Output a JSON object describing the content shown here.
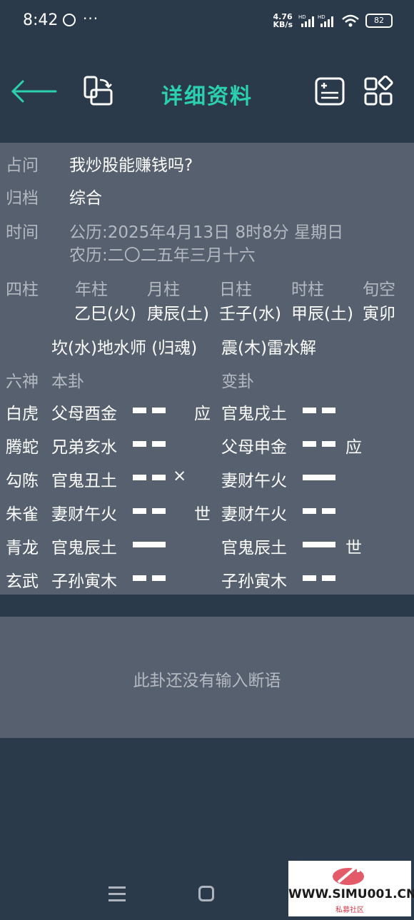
{
  "status": {
    "time": "8:42",
    "dots": "···",
    "speed": "4.76\nKB/s",
    "battery": "82"
  },
  "toolbar": {
    "title": "详细资料"
  },
  "info": {
    "question_label": "占问",
    "question": "我炒股能赚钱吗?",
    "category_label": "归档",
    "category": "综合",
    "time_label": "时间",
    "solar": "公历:2025年4月13日  8时8分 星期日",
    "lunar": "农历:二〇二五年三月十六"
  },
  "pillars": {
    "label": "四柱",
    "headers": [
      "年柱",
      "月柱",
      "日柱",
      "时柱",
      "旬空"
    ],
    "values": [
      "乙巳(火)",
      "庚辰(土)",
      "壬子(水)",
      "甲辰(土)",
      "寅卯"
    ]
  },
  "hexagram": {
    "main_name": "坎(水)地水师 (归魂)",
    "changed_name": "震(木)雷水解"
  },
  "liushen_header": {
    "label": "六神",
    "main": "本卦",
    "changed": "变卦"
  },
  "lines": [
    {
      "god": "白虎",
      "main": "父母酉金",
      "main_yao": "yin",
      "moving": "",
      "main_mark": "应",
      "changed": "官鬼戌土",
      "changed_yao": "yin",
      "changed_mark": ""
    },
    {
      "god": "腾蛇",
      "main": "兄弟亥水",
      "main_yao": "yin",
      "moving": "",
      "main_mark": "",
      "changed": "父母申金",
      "changed_yao": "yin",
      "changed_mark": "应"
    },
    {
      "god": "勾陈",
      "main": "官鬼丑土",
      "main_yao": "yin",
      "moving": "×",
      "main_mark": "",
      "changed": "妻财午火",
      "changed_yao": "yang",
      "changed_mark": ""
    },
    {
      "god": "朱雀",
      "main": "妻财午火",
      "main_yao": "yin",
      "moving": "",
      "main_mark": "世",
      "changed": "妻财午火",
      "changed_yao": "yin",
      "changed_mark": ""
    },
    {
      "god": "青龙",
      "main": "官鬼辰土",
      "main_yao": "yang",
      "moving": "",
      "main_mark": "",
      "changed": "官鬼辰土",
      "changed_yao": "yang",
      "changed_mark": "世"
    },
    {
      "god": "玄武",
      "main": "子孙寅木",
      "main_yao": "yin",
      "moving": "",
      "main_mark": "",
      "changed": "子孙寅木",
      "changed_yao": "yin",
      "changed_mark": ""
    }
  ],
  "empty_text": "此卦还没有输入断语",
  "watermark": {
    "url": "WWW.SIMU001.CN",
    "sub": "私募社区"
  },
  "colors": {
    "accent": "#2ad0b0",
    "panel": "#56606e",
    "background": "#2b3a4a"
  },
  "icons": [
    "back-arrow-icon",
    "swap-rotate-icon",
    "add-note-icon",
    "widgets-icon",
    "menu-icon",
    "home-icon"
  ]
}
